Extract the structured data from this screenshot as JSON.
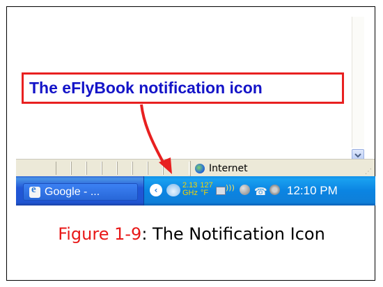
{
  "callout": {
    "text": "The eFlyBook notification icon"
  },
  "browser_status": {
    "zone_label": "Internet"
  },
  "taskbar": {
    "task_button_label": "Google - ...",
    "tray": {
      "cpu_speed": "2.13",
      "cpu_unit": "GHz",
      "temperature": "127",
      "temp_unit": "°F",
      "clock": "12:10 PM"
    }
  },
  "caption": {
    "figure_label": "Figure 1-9",
    "text": ": The Notification Icon"
  },
  "colors": {
    "callout_border": "#e82020",
    "callout_text": "#1414c8",
    "figure_label": "#e81818"
  }
}
